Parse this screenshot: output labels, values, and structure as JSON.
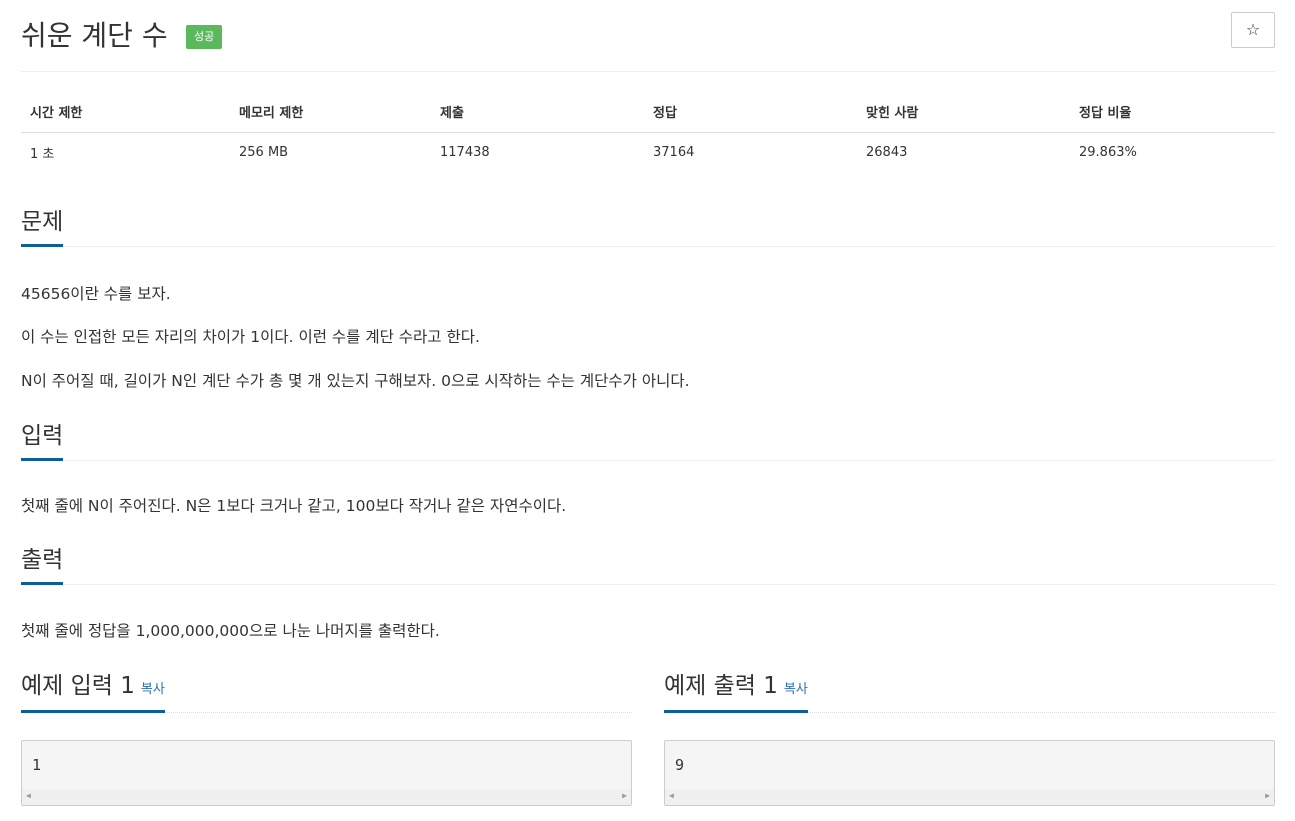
{
  "problem": {
    "title": "쉬운 계단 수",
    "badge": "성공",
    "star": "☆"
  },
  "info": {
    "headers": [
      "시간 제한",
      "메모리 제한",
      "제출",
      "정답",
      "맞힌 사람",
      "정답 비율"
    ],
    "values": [
      "1 초",
      "256 MB",
      "117438",
      "37164",
      "26843",
      "29.863%"
    ]
  },
  "sections": {
    "problem": {
      "title": "문제",
      "lines": [
        "45656이란 수를 보자.",
        "이 수는 인접한 모든 자리의 차이가 1이다. 이런 수를 계단 수라고 한다.",
        "N이 주어질 때, 길이가 N인 계단 수가 총 몇 개 있는지 구해보자. 0으로 시작하는 수는 계단수가 아니다."
      ]
    },
    "input": {
      "title": "입력",
      "text": "첫째 줄에 N이 주어진다. N은 1보다 크거나 같고, 100보다 작거나 같은 자연수이다."
    },
    "output": {
      "title": "출력",
      "text": "첫째 줄에 정답을 1,000,000,000으로 나눈 나머지를 출력한다."
    }
  },
  "samples": {
    "input": {
      "title": "예제 입력 1",
      "copy": "복사",
      "value": "1"
    },
    "output": {
      "title": "예제 출력 1",
      "copy": "복사",
      "value": "9"
    }
  },
  "colors": {
    "badge": "#5cb85c",
    "accent": "#0d5f9c",
    "link": "#2a6fb0"
  }
}
